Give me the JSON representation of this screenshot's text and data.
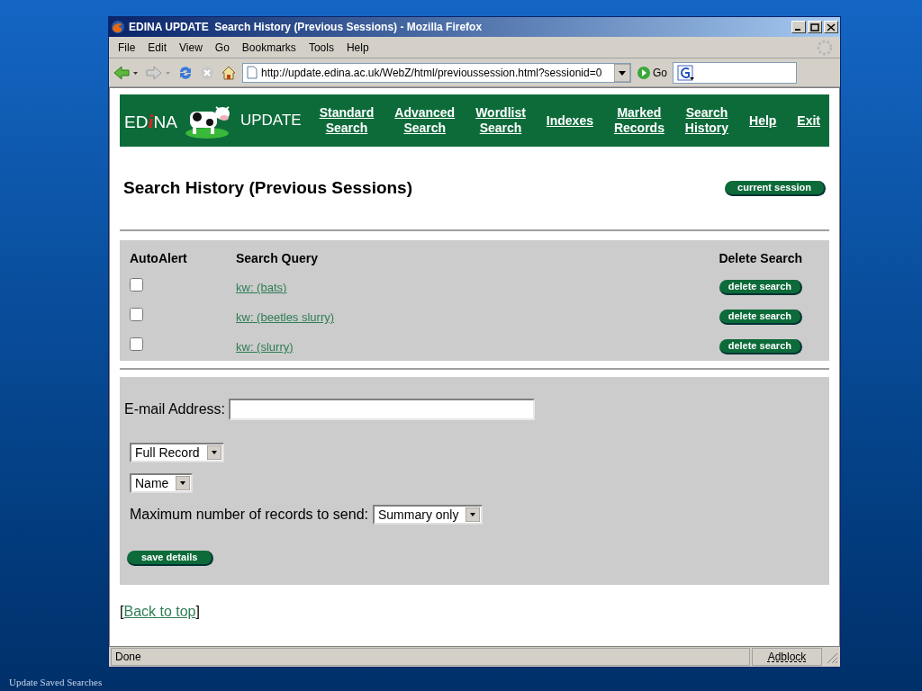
{
  "window": {
    "title": "EDINA UPDATE  Search History (Previous Sessions) - Mozilla Firefox"
  },
  "menu": [
    "File",
    "Edit",
    "View",
    "Go",
    "Bookmarks",
    "Tools",
    "Help"
  ],
  "toolbar": {
    "address": "http://update.edina.ac.uk/WebZ/html/previoussession.html?sessionid=0",
    "go": "Go"
  },
  "header": {
    "logo": {
      "before": "ED",
      "accent": "i",
      "after": "NA",
      "product": "UPDATE"
    },
    "nav": [
      {
        "lines": [
          "Standard",
          "Search"
        ]
      },
      {
        "lines": [
          "Advanced",
          "Search"
        ]
      },
      {
        "lines": [
          "Wordlist",
          "Search"
        ]
      },
      {
        "lines": [
          "Indexes"
        ]
      },
      {
        "lines": [
          "Marked",
          "Records"
        ]
      },
      {
        "lines": [
          "Search",
          "History"
        ]
      },
      {
        "lines": [
          "Help"
        ]
      },
      {
        "lines": [
          "Exit"
        ]
      }
    ]
  },
  "heading": "Search History (Previous Sessions)",
  "current_session_button": "current session",
  "table": {
    "columns": [
      "AutoAlert",
      "Search Query",
      "Delete Search"
    ],
    "rows": [
      {
        "checked": false,
        "query": "kw: (bats)",
        "action": "delete search"
      },
      {
        "checked": false,
        "query": "kw: (beetles slurry)",
        "action": "delete search"
      },
      {
        "checked": false,
        "query": "kw: (slurry)",
        "action": "delete search"
      }
    ]
  },
  "form": {
    "email_label": "E-mail Address:",
    "format_select": "Full Record",
    "sort_select": "Name",
    "max_label": "Maximum number of records to send:",
    "max_select": "Summary only",
    "save_button": "save details"
  },
  "back_to_top": {
    "open": "[",
    "link": "Back to top",
    "close": "]"
  },
  "status_bar": {
    "text": "Done",
    "adblock": "Adblock"
  },
  "slide_caption": "Update Saved Searches"
}
